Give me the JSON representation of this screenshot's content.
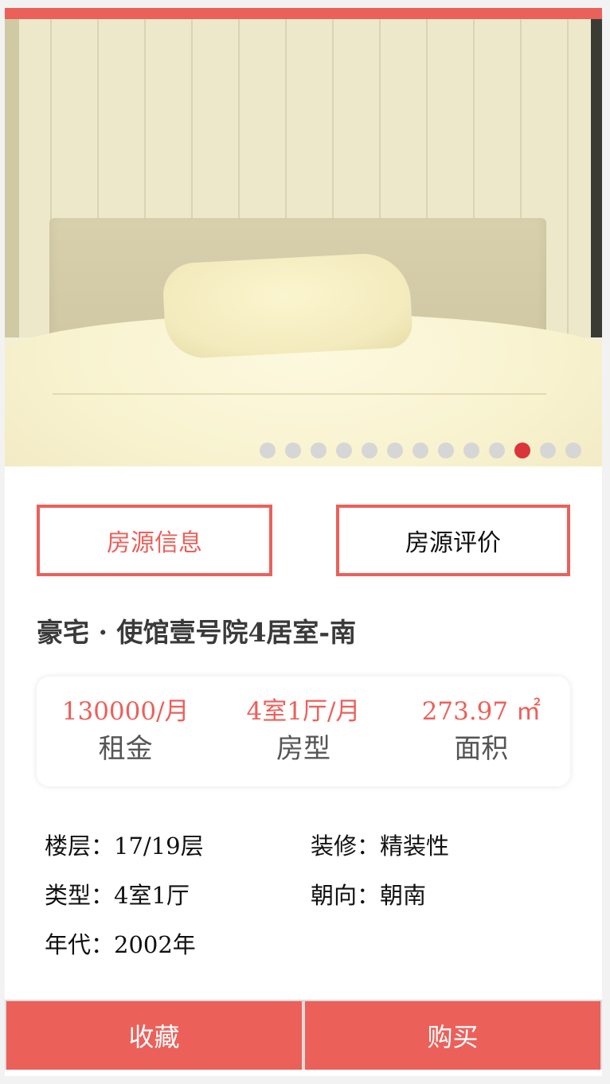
{
  "colors": {
    "accent": "#ec605a",
    "active_dot": "#d9353a",
    "inactive_dot": "#d6d6d6"
  },
  "carousel": {
    "image_subject": "bedroom-bed-photo",
    "dot_count": 13,
    "active_index": 10
  },
  "tabs": {
    "info_label": "房源信息",
    "review_label": "房源评价"
  },
  "listing": {
    "title": "豪宅 · 使馆壹号院4居室-南"
  },
  "stats": {
    "rent_value": "130000/月",
    "rent_label": "租金",
    "layout_value": "4室1厅/月",
    "layout_label": "房型",
    "area_value": "273.97 ㎡",
    "area_label": "面积"
  },
  "details": {
    "floor": "楼层：17/19层",
    "decoration": "装修：精装性",
    "type": "类型：4室1厅",
    "orientation": "朝向：朝南",
    "year": "年代：2002年"
  },
  "actions": {
    "favorite_label": "收藏",
    "buy_label": "购买"
  }
}
